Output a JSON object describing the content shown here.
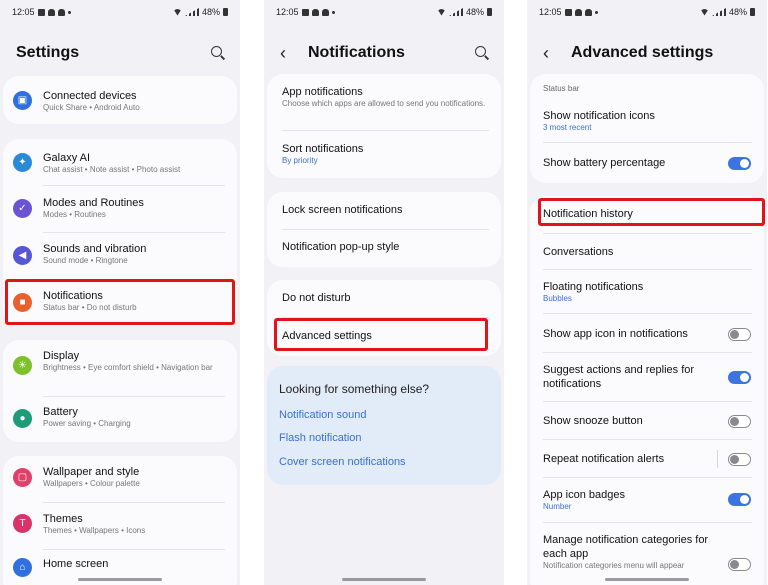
{
  "status": {
    "time": "12:05",
    "battery": "48%"
  },
  "settings": {
    "title": "Settings",
    "items": [
      {
        "title": "Connected devices",
        "sub": "Quick Share • Android Auto",
        "color": "#2f6fe0",
        "icon": "link-icon",
        "glyph": "▣"
      },
      {
        "title": "Galaxy AI",
        "sub": "Chat assist • Note assist • Photo assist",
        "color": "#2a8ad8",
        "icon": "sparkle-icon",
        "glyph": "✦"
      },
      {
        "title": "Modes and Routines",
        "sub": "Modes • Routines",
        "color": "#6b54d4",
        "icon": "check-circle-icon",
        "glyph": "✓"
      },
      {
        "title": "Sounds and vibration",
        "sub": "Sound mode • Ringtone",
        "color": "#5757d6",
        "icon": "speaker-icon",
        "glyph": "◀"
      },
      {
        "title": "Notifications",
        "sub": "Status bar • Do not disturb",
        "color": "#e8612c",
        "icon": "bell-icon",
        "glyph": "■"
      },
      {
        "title": "Display",
        "sub": "Brightness • Eye comfort shield • Navigation bar",
        "color": "#7cc12a",
        "icon": "sun-icon",
        "glyph": "☀"
      },
      {
        "title": "Battery",
        "sub": "Power saving • Charging",
        "color": "#1e9c7a",
        "icon": "battery-icon",
        "glyph": "●"
      },
      {
        "title": "Wallpaper and style",
        "sub": "Wallpapers • Colour palette",
        "color": "#e0406a",
        "icon": "image-icon",
        "glyph": "▢"
      },
      {
        "title": "Themes",
        "sub": "Themes • Wallpapers • Icons",
        "color": "#d9346a",
        "icon": "palette-icon",
        "glyph": "T"
      },
      {
        "title": "Home screen",
        "sub": "",
        "color": "#2f6fe0",
        "icon": "home-icon",
        "glyph": "⌂"
      }
    ]
  },
  "notifications": {
    "title": "Notifications",
    "app_notifications": {
      "title": "App notifications",
      "sub": "Choose which apps are allowed to send you notifications."
    },
    "sort_notifications": {
      "title": "Sort notifications",
      "sub": "By priority"
    },
    "lock_screen": "Lock screen notifications",
    "popup_style": "Notification pop-up style",
    "do_not_disturb": "Do not disturb",
    "advanced_settings": "Advanced settings",
    "suggest": {
      "heading": "Looking for something else?",
      "links": [
        "Notification sound",
        "Flash notification",
        "Cover screen notifications"
      ]
    }
  },
  "advanced": {
    "title": "Advanced settings",
    "section": "Status bar",
    "show_icons": {
      "title": "Show notification icons",
      "sub": "3 most recent"
    },
    "battery_pct": {
      "title": "Show battery percentage",
      "on": true
    },
    "history": "Notification history",
    "conversations": "Conversations",
    "floating": {
      "title": "Floating notifications",
      "sub": "Bubbles"
    },
    "app_icon": {
      "title": "Show app icon in notifications",
      "on": false
    },
    "suggest_actions": {
      "title": "Suggest actions and replies for notifications",
      "on": true
    },
    "snooze": {
      "title": "Show snooze button",
      "on": false
    },
    "repeat": {
      "title": "Repeat notification alerts",
      "on": false
    },
    "badges": {
      "title": "App icon badges",
      "sub": "Number",
      "on": true
    },
    "manage": {
      "title": "Manage notification categories for each app",
      "sub": "Notification categories menu will appear",
      "on": false
    }
  }
}
